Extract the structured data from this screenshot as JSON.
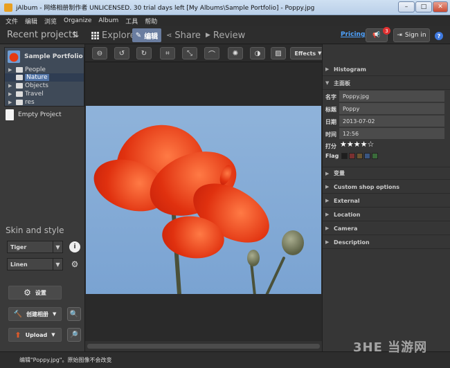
{
  "window": {
    "title": "jAlbum - 网络相册制作者 UNLICENSED. 30 trial days left [My Albums\\Sample Portfolio] - Poppy.jpg",
    "minimize": "–",
    "maximize": "□",
    "close": "✕"
  },
  "menu": [
    "文件",
    "编辑",
    "浏览",
    "Organize",
    "Album",
    "工具",
    "帮助"
  ],
  "topbar": {
    "recent_projects": "Recent projects",
    "sort_icon": "⇅",
    "tabs": [
      {
        "label": "Explore",
        "icon": "grid-icon"
      },
      {
        "label": "编辑",
        "icon": "pencil-icon"
      },
      {
        "label": "Share",
        "icon": "share-icon"
      },
      {
        "label": "Review",
        "icon": "play-icon"
      }
    ],
    "pricing": "Pricing",
    "notification_count": "3",
    "sign_in": "Sign in",
    "help": "?"
  },
  "projects": {
    "current": "Sample Portfolio",
    "folders": [
      {
        "label": "People",
        "selected": false
      },
      {
        "label": "Nature",
        "selected": true
      },
      {
        "label": "Objects",
        "selected": false
      },
      {
        "label": "Travel",
        "selected": false
      },
      {
        "label": "res",
        "selected": false
      }
    ],
    "empty_project": "Empty Project"
  },
  "skin": {
    "title": "Skin and style",
    "skin_value": "Tiger",
    "style_value": "Linen"
  },
  "actions": {
    "settings": "设置",
    "create_album": "创建相册",
    "upload": "Upload"
  },
  "edit_toolbar": {
    "effects": "Effects"
  },
  "properties": {
    "histogram": "Histogram",
    "main_panel": "主面板",
    "fields": [
      {
        "label": "名字",
        "value": "Poppy.jpg"
      },
      {
        "label": "标题",
        "value": "Poppy"
      },
      {
        "label": "日期",
        "value": "2013-07-02"
      },
      {
        "label": "时间",
        "value": "12:56"
      }
    ],
    "rating_label": "打分",
    "rating_stars": "★★★★☆",
    "rating_value": 4,
    "flag_label": "Flag",
    "flag_colors": [
      "#1e1e1e",
      "#7a3030",
      "#6a5530",
      "#3a5580",
      "#3a6a3a"
    ],
    "sections": [
      "变量",
      "Custom shop options",
      "External",
      "Location",
      "Camera",
      "Description"
    ]
  },
  "status": "编辑\"Poppy.jpg\"。原始图像不会改变",
  "watermark": "3HE 当游网"
}
